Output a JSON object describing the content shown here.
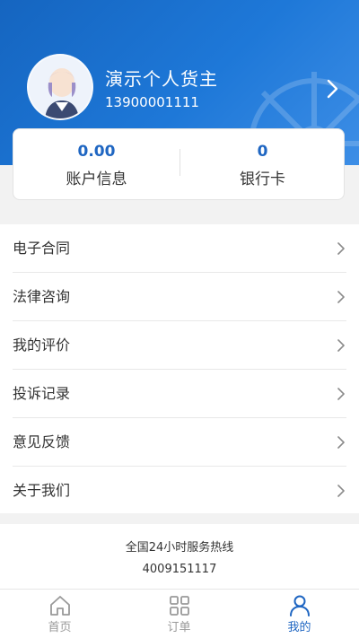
{
  "profile": {
    "name": "演示个人货主",
    "phone": "13900001111"
  },
  "stats": [
    {
      "value": "0.00",
      "label": "账户信息"
    },
    {
      "value": "0",
      "label": "银行卡"
    }
  ],
  "menu": {
    "items": [
      {
        "label": "电子合同"
      },
      {
        "label": "法律咨询"
      },
      {
        "label": "我的评价"
      },
      {
        "label": "投诉记录"
      },
      {
        "label": "意见反馈"
      },
      {
        "label": "关于我们"
      }
    ]
  },
  "hotline": {
    "title": "全国24小时服务热线",
    "number": "4009151117"
  },
  "tabbar": {
    "tabs": [
      {
        "label": "首页",
        "icon": "home-icon"
      },
      {
        "label": "订单",
        "icon": "grid-icon"
      },
      {
        "label": "我的",
        "icon": "user-icon"
      }
    ],
    "active": "我的"
  },
  "colors": {
    "header": "#1e78d8",
    "accent": "#1f66c2",
    "inactive": "#999999",
    "background": "#f2f2f2"
  }
}
